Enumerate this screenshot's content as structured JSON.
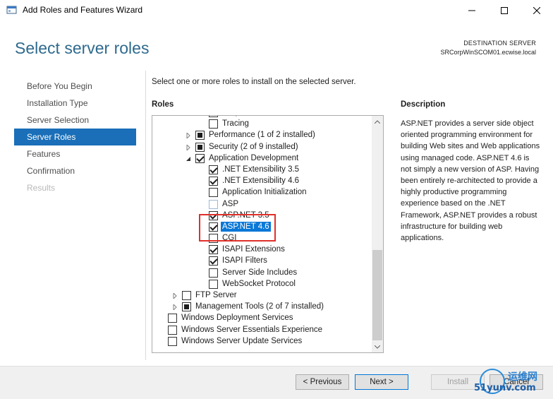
{
  "window": {
    "title": "Add Roles and Features Wizard"
  },
  "header": {
    "title": "Select server roles",
    "destination_label": "DESTINATION SERVER",
    "destination_server": "SRCorpWinSCOM01.ecwise.local"
  },
  "nav": {
    "items": [
      {
        "label": "Before You Begin",
        "state": "normal"
      },
      {
        "label": "Installation Type",
        "state": "normal"
      },
      {
        "label": "Server Selection",
        "state": "normal"
      },
      {
        "label": "Server Roles",
        "state": "active"
      },
      {
        "label": "Features",
        "state": "normal"
      },
      {
        "label": "Confirmation",
        "state": "normal"
      },
      {
        "label": "Results",
        "state": "disabled"
      }
    ]
  },
  "main": {
    "instruction": "Select one or more roles to install on the selected server.",
    "roles_label": "Roles",
    "description_label": "Description",
    "description_text": "ASP.NET provides a server side object oriented programming environment for building Web sites and Web applications using managed code. ASP.NET 4.6 is not simply a new version of ASP. Having been entirely re-architected to provide a highly productive programming experience based on the .NET Framework, ASP.NET provides a robust infrastructure for building web applications."
  },
  "roles_tree": [
    {
      "label": "Request Monitor",
      "level": 3,
      "state": "unchecked",
      "expander": "none"
    },
    {
      "label": "Tracing",
      "level": 3,
      "state": "unchecked",
      "expander": "none"
    },
    {
      "label": "Performance (1 of 2 installed)",
      "level": 2,
      "state": "partial",
      "expander": "collapsed"
    },
    {
      "label": "Security (2 of 9 installed)",
      "level": 2,
      "state": "partial",
      "expander": "collapsed"
    },
    {
      "label": "Application Development",
      "level": 2,
      "state": "checked",
      "expander": "expanded"
    },
    {
      "label": ".NET Extensibility 3.5",
      "level": 3,
      "state": "checked",
      "expander": "none"
    },
    {
      "label": ".NET Extensibility 4.6",
      "level": 3,
      "state": "checked",
      "expander": "none"
    },
    {
      "label": "Application Initialization",
      "level": 3,
      "state": "unchecked",
      "expander": "none"
    },
    {
      "label": "ASP",
      "level": 3,
      "state": "unchecked-light",
      "expander": "none"
    },
    {
      "label": "ASP.NET 3.5",
      "level": 3,
      "state": "checked",
      "expander": "none"
    },
    {
      "label": "ASP.NET 4.6",
      "level": 3,
      "state": "checked",
      "expander": "none",
      "selected": true
    },
    {
      "label": "CGI",
      "level": 3,
      "state": "unchecked",
      "expander": "none"
    },
    {
      "label": "ISAPI Extensions",
      "level": 3,
      "state": "checked",
      "expander": "none"
    },
    {
      "label": "ISAPI Filters",
      "level": 3,
      "state": "checked",
      "expander": "none"
    },
    {
      "label": "Server Side Includes",
      "level": 3,
      "state": "unchecked",
      "expander": "none"
    },
    {
      "label": "WebSocket Protocol",
      "level": 3,
      "state": "unchecked",
      "expander": "none"
    },
    {
      "label": "FTP Server",
      "level": 1,
      "state": "unchecked",
      "expander": "collapsed"
    },
    {
      "label": "Management Tools (2 of 7 installed)",
      "level": 1,
      "state": "partial",
      "expander": "collapsed"
    },
    {
      "label": "Windows Deployment Services",
      "level": 0,
      "state": "unchecked",
      "expander": "none"
    },
    {
      "label": "Windows Server Essentials Experience",
      "level": 0,
      "state": "unchecked",
      "expander": "none"
    },
    {
      "label": "Windows Server Update Services",
      "level": 0,
      "state": "unchecked",
      "expander": "none"
    }
  ],
  "footer": {
    "previous_label": "< Previous",
    "next_label": "Next >",
    "install_label": "Install",
    "cancel_label": "Cancel"
  },
  "watermark": {
    "text_cn": "运维网",
    "text_domain": "51yunv.com"
  },
  "colors": {
    "accent": "#1a6fb8",
    "title_blue": "#2e6a8e",
    "selection": "#0b78d7",
    "highlight_red": "#e0302a"
  }
}
